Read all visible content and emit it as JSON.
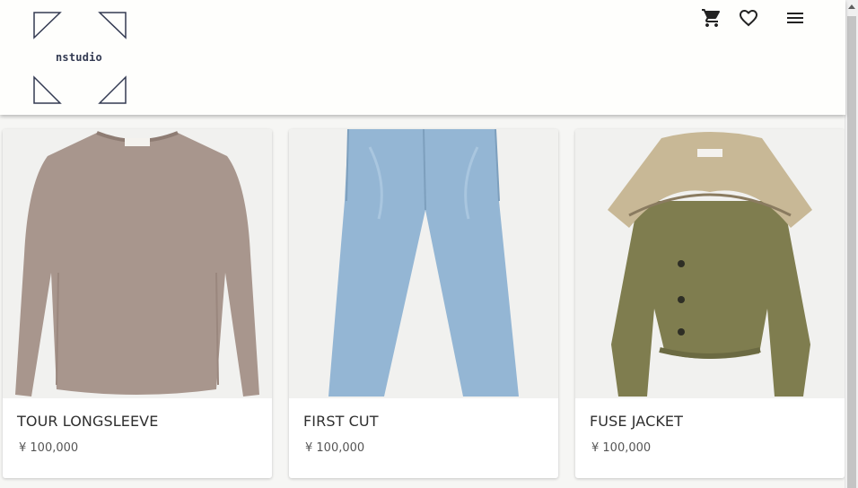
{
  "brand": {
    "name": "nstudio",
    "logo_icon": "triangle-corner-logo",
    "line_color": "#333a52"
  },
  "header": {
    "icons": [
      {
        "name": "cart-icon"
      },
      {
        "name": "heart-icon"
      },
      {
        "name": "menu-icon"
      }
    ]
  },
  "products": [
    {
      "name": "TOUR LONGSLEEVE",
      "price": "¥ 100,000",
      "image": "taupe longsleeve shirt",
      "color": "#a8968d"
    },
    {
      "name": "FIRST CUT",
      "price": "¥ 100,000",
      "image": "light blue denim jeans",
      "color": "#94b6d4"
    },
    {
      "name": "FUSE JACKET",
      "price": "¥ 100,000",
      "image": "olive green jacket with knit collar",
      "color": "#7f7d4f"
    }
  ]
}
